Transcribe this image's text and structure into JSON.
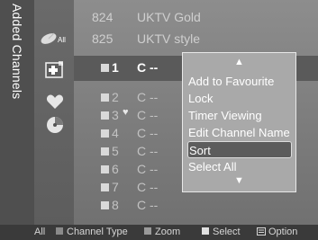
{
  "side_tab": {
    "label": "Added Channels"
  },
  "icons": {
    "all_label": "All"
  },
  "top_rows": [
    {
      "number": "824",
      "name": "UKTV Gold"
    },
    {
      "number": "825",
      "name": "UKTV style"
    }
  ],
  "channels": [
    {
      "number": "1",
      "name": "C --"
    },
    {
      "number": "2",
      "name": "C --"
    },
    {
      "number": "3",
      "name": "C --"
    },
    {
      "number": "4",
      "name": "C --"
    },
    {
      "number": "5",
      "name": "C --"
    },
    {
      "number": "6",
      "name": "C --"
    },
    {
      "number": "7",
      "name": "C --"
    },
    {
      "number": "8",
      "name": "C --"
    }
  ],
  "menu": {
    "up_arrow": "▲",
    "down_arrow": "▼",
    "items": [
      "Add to Favourite",
      "Lock",
      "Timer Viewing",
      "Edit Channel Name",
      "Sort",
      "Select All"
    ],
    "selected": "Sort"
  },
  "bottom_bar": {
    "all": "All",
    "channel_type": "Channel Type",
    "zoom": "Zoom",
    "select": "Select",
    "option": "Option"
  },
  "colors": {
    "channel_type_key": "#8a8a8a",
    "zoom_key": "#9a9a9a",
    "select_key": "#e0e0e0"
  }
}
